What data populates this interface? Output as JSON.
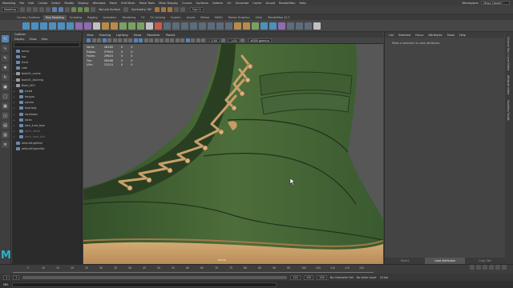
{
  "menubar": {
    "items": [
      "Modeling",
      "File",
      "Edit",
      "Create",
      "Select",
      "Modify",
      "Display",
      "Windows",
      "Mesh",
      "Edit Mesh",
      "Mesh Tools",
      "Mesh Display",
      "Curves",
      "Surfaces",
      "Deform",
      "UV",
      "Generate",
      "Cache",
      "Arnold",
      "RenderMan",
      "Help"
    ],
    "workspace_label": "Workspace:",
    "workspace_value": "Maya Classic*"
  },
  "statusline": {
    "mode": "Modeling",
    "live_surface": "No Live Surface",
    "symmetry": "Symmetry: Off",
    "sign_in": "Sign In"
  },
  "shelf_tabs": [
    "Curves / Surfaces",
    "Poly Modeling",
    "Sculpting",
    "Rigging",
    "Animation",
    "Rendering",
    "FX",
    "FX Caching",
    "Custom",
    "Arnold",
    "Bifrost",
    "MASH",
    "Motion Graphics",
    "XGen",
    "RenderMan 22.2"
  ],
  "shelf_active": "Poly Modeling",
  "outliner": {
    "title": "Outliner",
    "menu": [
      "Display",
      "Show",
      "Help"
    ],
    "rows": [
      {
        "label": "persp",
        "type": "cam",
        "dim": false
      },
      {
        "label": "top",
        "type": "cam",
        "dim": false
      },
      {
        "label": "front",
        "type": "cam",
        "dim": false
      },
      {
        "label": "side",
        "type": "cam",
        "dim": false
      },
      {
        "label": "boot01_cache",
        "type": "grp",
        "dim": false
      },
      {
        "label": "boot01_backing",
        "type": "grp",
        "dim": false
      },
      {
        "label": "Boot_GEO",
        "type": "grp",
        "dim": false
      },
      {
        "label": "tread",
        "type": "mesh",
        "dim": false
      },
      {
        "label": "tongue",
        "type": "mesh",
        "dim": false
      },
      {
        "label": "panels",
        "type": "mesh",
        "dim": false
      },
      {
        "label": "bootlegs",
        "type": "mesh",
        "dim": false
      },
      {
        "label": "laceloops",
        "type": "mesh",
        "dim": false
      },
      {
        "label": "laces",
        "type": "mesh",
        "dim": false
      },
      {
        "label": "lace_knot_bow",
        "type": "mesh",
        "dim": false
      },
      {
        "label": "back_detail",
        "type": "mesh",
        "dim": true
      },
      {
        "label": "back_boot_bits",
        "type": "mesh",
        "dim": true
      },
      {
        "label": "defaultLightSet",
        "type": "set",
        "dim": false
      },
      {
        "label": "defaultObjectSet",
        "type": "set",
        "dim": false
      }
    ]
  },
  "viewport": {
    "menu": [
      "View",
      "Shading",
      "Lighting",
      "Show",
      "Renderer",
      "Panels"
    ],
    "exposure": "0.00",
    "gamma": "1.00",
    "colorspace": "sRGB gamma",
    "hud": [
      {
        "label": "Verts:",
        "a": "28180",
        "b": "0",
        "c": "0"
      },
      {
        "label": "Edges:",
        "a": "57694",
        "b": "0",
        "c": "0"
      },
      {
        "label": "Faces:",
        "a": "29620",
        "b": "0",
        "c": "0"
      },
      {
        "label": "Tris:",
        "a": "56468",
        "b": "0",
        "c": "0"
      },
      {
        "label": "UVs:",
        "a": "31310",
        "b": "0",
        "c": "0"
      }
    ],
    "camera_label": "persp"
  },
  "attribute_panel": {
    "menu": [
      "List",
      "Selected",
      "Focus",
      "Attributes",
      "Show",
      "Help"
    ],
    "message": "Make a selection to view attributes",
    "tabs": [
      "Select",
      "Load Attributes",
      "Copy Tab"
    ],
    "side_tabs": [
      "Channel Box / Layer Editor",
      "Attribute Editor",
      "Modeling Toolkit"
    ]
  },
  "timeline": {
    "ticks": [
      "5",
      "10",
      "15",
      "20",
      "25",
      "30",
      "35",
      "40",
      "45",
      "50",
      "55",
      "60",
      "65",
      "70",
      "75",
      "80",
      "85",
      "90",
      "95",
      "100",
      "105",
      "110",
      "115",
      "120"
    ],
    "current_frame": "1"
  },
  "range": {
    "start": "1",
    "start_inner": "1",
    "end_inner": "120",
    "end": "120",
    "end_outer": "200",
    "char_set": "No Character Set",
    "anim_layer": "No Anim Layer",
    "fps": "24 fps"
  },
  "cmdline": {
    "label": "MEL"
  }
}
